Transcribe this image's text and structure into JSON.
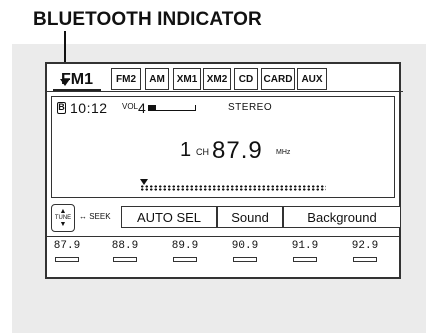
{
  "caption": "BLUETOOTH INDICATOR",
  "tabs": [
    {
      "label": "FM1"
    },
    {
      "label": "FM2"
    },
    {
      "label": "AM"
    },
    {
      "label": "XM1"
    },
    {
      "label": "XM2"
    },
    {
      "label": "CD"
    },
    {
      "label": "CARD"
    },
    {
      "label": "AUX"
    }
  ],
  "status": {
    "bluetooth_symbol": "B",
    "clock": "10:12",
    "vol_label": "VOL",
    "vol_value": "4",
    "vol_level": 0.15,
    "stereo": "STEREO"
  },
  "tuner": {
    "channel": "1",
    "channel_label": "CH",
    "frequency": "87.9",
    "unit": "MHz"
  },
  "controls": {
    "tune_label": "TUNE",
    "seek_label": "↔ SEEK",
    "auto_sel": "AUTO SEL",
    "sound": "Sound",
    "background": "Background"
  },
  "presets": [
    "87.9",
    "88.9",
    "89.9",
    "90.9",
    "91.9",
    "92.9"
  ],
  "colors": {
    "panel": "#ebebeb",
    "text": "#111111"
  }
}
